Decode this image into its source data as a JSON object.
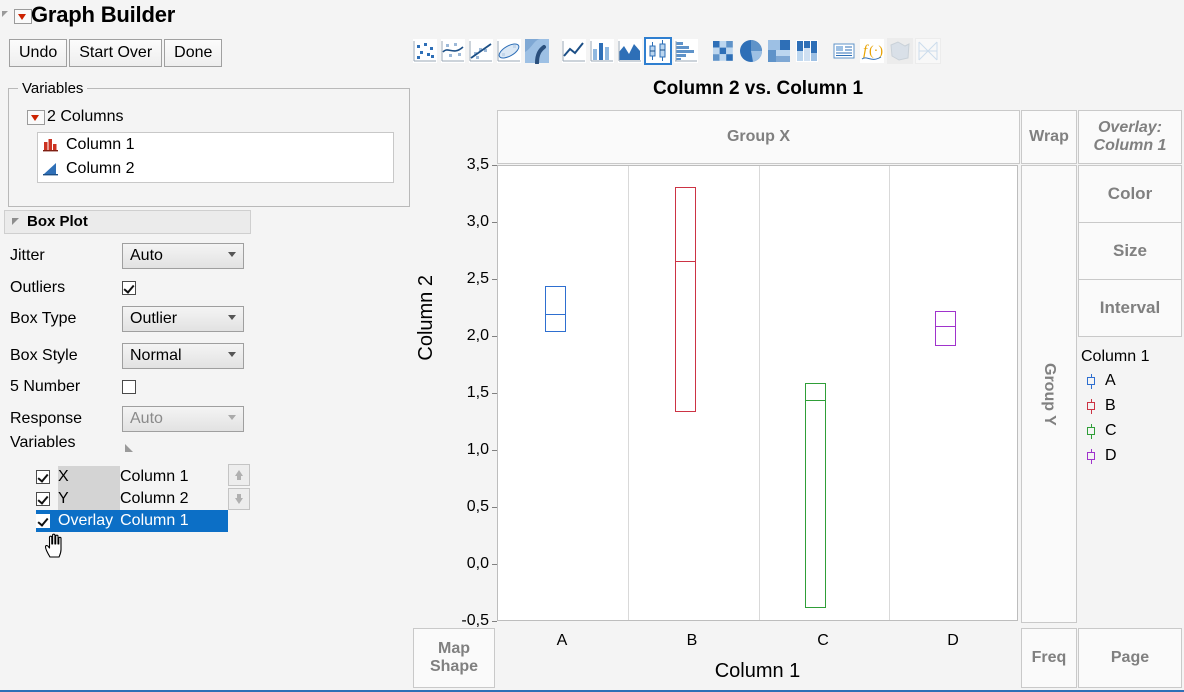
{
  "window": {
    "title": "Graph Builder"
  },
  "toolbar_buttons": [
    {
      "label": "Undo",
      "name": "undo-button"
    },
    {
      "label": "Start Over",
      "name": "start-over-button"
    },
    {
      "label": "Done",
      "name": "done-button"
    }
  ],
  "graph_type_toolbar": {
    "icons": [
      {
        "name": "points-icon",
        "selected": false,
        "enabled": true
      },
      {
        "name": "smoother-icon",
        "selected": false,
        "enabled": true
      },
      {
        "name": "line-of-fit-icon",
        "selected": false,
        "enabled": true
      },
      {
        "name": "ellipse-icon",
        "selected": false,
        "enabled": true
      },
      {
        "name": "contour-icon",
        "selected": false,
        "enabled": true
      },
      {
        "name": "line-icon",
        "selected": false,
        "enabled": true
      },
      {
        "name": "bar-icon",
        "selected": false,
        "enabled": true
      },
      {
        "name": "area-icon",
        "selected": false,
        "enabled": true
      },
      {
        "name": "box-plot-icon",
        "selected": true,
        "enabled": true
      },
      {
        "name": "histogram-icon",
        "selected": false,
        "enabled": true
      },
      {
        "name": "heatmap-icon",
        "selected": false,
        "enabled": true
      },
      {
        "name": "pie-icon",
        "selected": false,
        "enabled": true
      },
      {
        "name": "treemap-icon",
        "selected": false,
        "enabled": true
      },
      {
        "name": "mosaic-icon",
        "selected": false,
        "enabled": true
      },
      {
        "name": "caption-box-icon",
        "selected": false,
        "enabled": true
      },
      {
        "name": "formula-icon",
        "selected": false,
        "enabled": true
      },
      {
        "name": "map-shapes-icon",
        "selected": false,
        "enabled": false
      },
      {
        "name": "parallel-plot-icon",
        "selected": false,
        "enabled": false
      }
    ]
  },
  "variables_panel": {
    "group_label": "Variables",
    "columns_header": "2 Columns",
    "columns": [
      {
        "name": "Column 1",
        "type": "nominal",
        "icon": "nominal-bar-icon",
        "color": "#cc3322"
      },
      {
        "name": "Column 2",
        "type": "continuous",
        "icon": "continuous-triangle-icon",
        "color": "#2e6fb7"
      }
    ]
  },
  "box_plot_panel": {
    "title": "Box Plot",
    "options": [
      {
        "label": "Jitter",
        "control": "select",
        "value": "Auto",
        "enabled": true
      },
      {
        "label": "Outliers",
        "control": "checkbox",
        "checked": true,
        "enabled": true
      },
      {
        "label": "Box Type",
        "control": "select",
        "value": "Outlier",
        "enabled": true
      },
      {
        "label": "Box Style",
        "control": "select",
        "value": "Normal",
        "enabled": true
      },
      {
        "label": "5 Number",
        "control": "checkbox",
        "checked": false,
        "enabled": true
      },
      {
        "label": "Response",
        "control": "select",
        "value": "Auto",
        "enabled": false
      }
    ],
    "variables_label": "Variables",
    "variable_roles": [
      {
        "role": "X",
        "column": "Column 1",
        "checked": true,
        "selected": false
      },
      {
        "role": "Y",
        "column": "Column 2",
        "checked": true,
        "selected": false
      },
      {
        "role": "Overlay",
        "column": "Column 1",
        "checked": true,
        "selected": true
      }
    ]
  },
  "drop_zones": {
    "group_x": "Group X",
    "wrap": "Wrap",
    "overlay_line1": "Overlay:",
    "overlay_line2": "Column 1",
    "group_y": "Group Y",
    "color": "Color",
    "size": "Size",
    "interval": "Interval",
    "map_shape_line1": "Map",
    "map_shape_line2": "Shape",
    "freq": "Freq",
    "page": "Page"
  },
  "legend": {
    "title": "Column 1",
    "items": [
      {
        "label": "A",
        "color": "#2e6fd0"
      },
      {
        "label": "B",
        "color": "#cc3344"
      },
      {
        "label": "C",
        "color": "#2f9e38"
      },
      {
        "label": "D",
        "color": "#a033cc"
      }
    ]
  },
  "chart_data": {
    "type": "box",
    "title": "Column 2 vs. Column 1",
    "xlabel": "Column 1",
    "ylabel": "Column 2",
    "categories": [
      "A",
      "B",
      "C",
      "D"
    ],
    "ylim": [
      -0.5,
      3.5
    ],
    "ytick_labels": [
      "3,5",
      "3,0",
      "2,5",
      "2,0",
      "1,5",
      "1,0",
      "0,5",
      "0,0",
      "-0,5"
    ],
    "ytick_values": [
      3.5,
      3.0,
      2.5,
      2.0,
      1.5,
      1.0,
      0.5,
      0.0,
      -0.5
    ],
    "grid": "vertical",
    "legend_position": "right",
    "decimal_separator": ",",
    "series": [
      {
        "name": "A",
        "color": "#2e6fd0",
        "q1": 2.05,
        "median": 2.2,
        "q3": 2.45
      },
      {
        "name": "B",
        "color": "#cc3344",
        "q1": 1.35,
        "median": 2.67,
        "q3": 3.32
      },
      {
        "name": "C",
        "color": "#2f9e38",
        "q1": -0.37,
        "median": 1.45,
        "q3": 1.6
      },
      {
        "name": "D",
        "color": "#a033cc",
        "q1": 1.92,
        "median": 2.1,
        "q3": 2.23
      }
    ]
  }
}
